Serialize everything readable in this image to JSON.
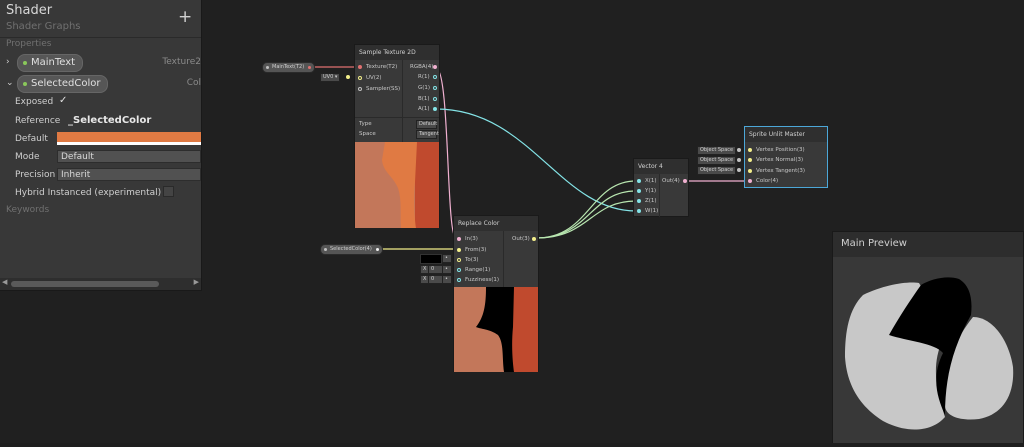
{
  "blackboard": {
    "title": "Shader",
    "subtitle": "Shader Graphs",
    "plus": "+",
    "properties_label": "Properties",
    "keywords_label": "Keywords",
    "property_1": {
      "name": "MainText",
      "type": "Texture2",
      "arrow": "›"
    },
    "property_2": {
      "name": "SelectedColor",
      "type": "Col",
      "arrow": "⌄"
    },
    "exposed_label": "Exposed",
    "exposed_check": "✓",
    "reference_label": "Reference",
    "reference_value": "_SelectedColor",
    "default_label": "Default",
    "default_color": "#e07a43",
    "mode_label": "Mode",
    "mode_value": "Default",
    "precision_label": "Precision",
    "precision_value": "Inherit",
    "hybrid_label": "Hybrid Instanced (experimental)",
    "scroll_left": "◀",
    "scroll_right": "▶"
  },
  "nodes": {
    "sample_texture": {
      "title": "Sample Texture 2D",
      "inputs": [
        "Texture(T2)",
        "UV(2)",
        "Sampler(SS)"
      ],
      "outputs": [
        "RGBA(4)",
        "R(1)",
        "G(1)",
        "B(1)",
        "A(1)"
      ],
      "uv_chip": "UV0 ▾",
      "type_label": "Type",
      "type_value": "Default",
      "space_label": "Space",
      "space_value": "Tangent"
    },
    "replace_color": {
      "title": "Replace Color",
      "inputs": [
        "In(3)",
        "From(3)",
        "To(3)",
        "Range(1)",
        "Fuzziness(1)"
      ],
      "output": "Out(3)",
      "range_x": "X",
      "range_val": "0",
      "fuzz_x": "X",
      "fuzz_val": "0"
    },
    "vector4": {
      "title": "Vector 4",
      "inputs": [
        "X(1)",
        "Y(1)",
        "Z(1)",
        "W(1)"
      ],
      "output": "Out(4)"
    },
    "sprite_master": {
      "title": "Sprite Unlit Master",
      "inputs": [
        "Vertex Position(3)",
        "Vertex Normal(3)",
        "Vertex Tangent(3)",
        "Color(4)"
      ],
      "space_chips": [
        "Object Space",
        "Object Space",
        "Object Space"
      ]
    }
  },
  "property_nodes": {
    "main_text": "MainText(T2)",
    "selected_color": "SelectedColor(4)"
  },
  "main_preview": {
    "title": "Main Preview"
  },
  "colors": {
    "orange": "#e07a43",
    "dark_orange": "#c04a2e",
    "salmon": "#c3775a",
    "accent_blue": "#4ca7d8"
  }
}
